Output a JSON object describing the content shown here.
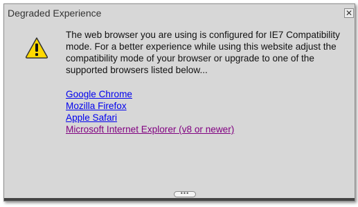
{
  "dialog": {
    "title": "Degraded Experience",
    "close_label": "✕",
    "warning_icon": "warning-icon",
    "message": "The web browser you are using is configured for IE7 Compatibility mode. For a better experience while using this website adjust the compatibility mode of your browser or upgrade to one of the supported browsers listed below...",
    "links": [
      {
        "label": "Google Chrome",
        "visited": false
      },
      {
        "label": "Mozilla Firefox",
        "visited": false
      },
      {
        "label": "Apple Safari",
        "visited": false
      },
      {
        "label": "Microsoft Internet Explorer (v8 or newer)",
        "visited": true
      }
    ],
    "handle_label": "•••"
  },
  "colors": {
    "background": "#d7d7d7",
    "link": "#0000ee",
    "visited_link": "#800080",
    "warning_yellow": "#ffd800"
  }
}
